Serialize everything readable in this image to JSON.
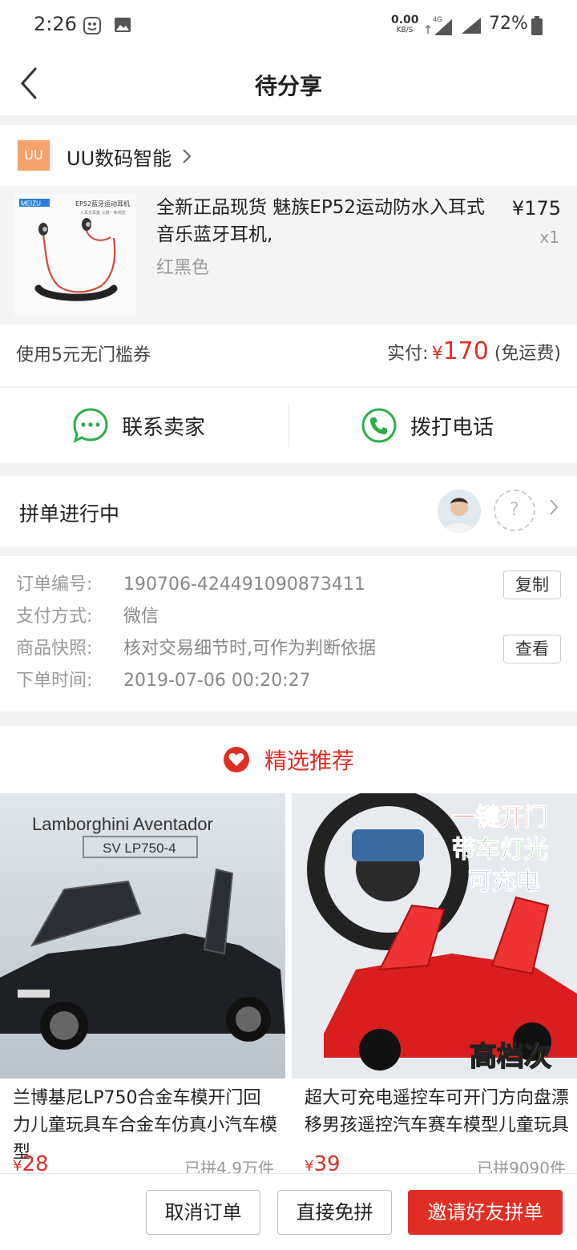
{
  "status_bar": {
    "time": "2:26",
    "net_speed": "0.00",
    "net_speed_unit": "KB/S",
    "network_type": "4G",
    "battery": "72%"
  },
  "header": {
    "title": "待分享"
  },
  "shop": {
    "logo_text": "UU",
    "name": "UU数码智能"
  },
  "product": {
    "title": "全新正品现货 魅族EP52运动防水入耳式音乐蓝牙耳机,",
    "spec": "红黑色",
    "price": "¥175",
    "quantity": "x1",
    "thumb_brand": "MEIZU",
    "thumb_caption": "EP52蓝牙运动耳机",
    "thumb_subcaption": "入耳式耳塞 三键一体线控"
  },
  "coupon": {
    "text": "使用5元无门槛券",
    "paid_label": "实付:",
    "paid_currency": "¥",
    "paid_amount": "170",
    "shipping_note": "(免运费)"
  },
  "contact": {
    "seller_label": "联系卖家",
    "phone_label": "拨打电话"
  },
  "group": {
    "status_label": "拼单进行中",
    "unknown_member": "?"
  },
  "order_info": {
    "order_no_label": "订单编号:",
    "order_no": "190706-424491090873411",
    "copy_label": "复制",
    "payment_label": "支付方式:",
    "payment": "微信",
    "snapshot_label": "商品快照:",
    "snapshot": "核对交易细节时,可作为判断依据",
    "view_label": "查看",
    "time_label": "下单时间:",
    "time": "2019-07-06 00:20:27"
  },
  "recommend": {
    "title": "精选推荐",
    "items": [
      {
        "name": "兰博基尼LP750合金车模开门回力儿童玩具车合金车仿真小汽车模型",
        "currency": "¥",
        "price": "28",
        "sold": "已拼4.9万件",
        "img_title": "Lamborghini Aventador",
        "img_subtitle": "SV LP750-4"
      },
      {
        "name": "超大可充电遥控车可开门方向盘漂移男孩遥控汽车赛车模型儿童玩具",
        "currency": "¥",
        "price": "39",
        "sold": "已拼9090件",
        "img_tag1": "一键开门",
        "img_tag2": "带车灯光",
        "img_tag3": "可充电",
        "img_tag4": "高档次"
      }
    ]
  },
  "actions": {
    "cancel": "取消订单",
    "direct": "直接免拼",
    "invite": "邀请好友拼单"
  },
  "colors": {
    "accent": "#e02e24",
    "wechat_green": "#2aae47",
    "shop_logo": "#f5a36a"
  }
}
